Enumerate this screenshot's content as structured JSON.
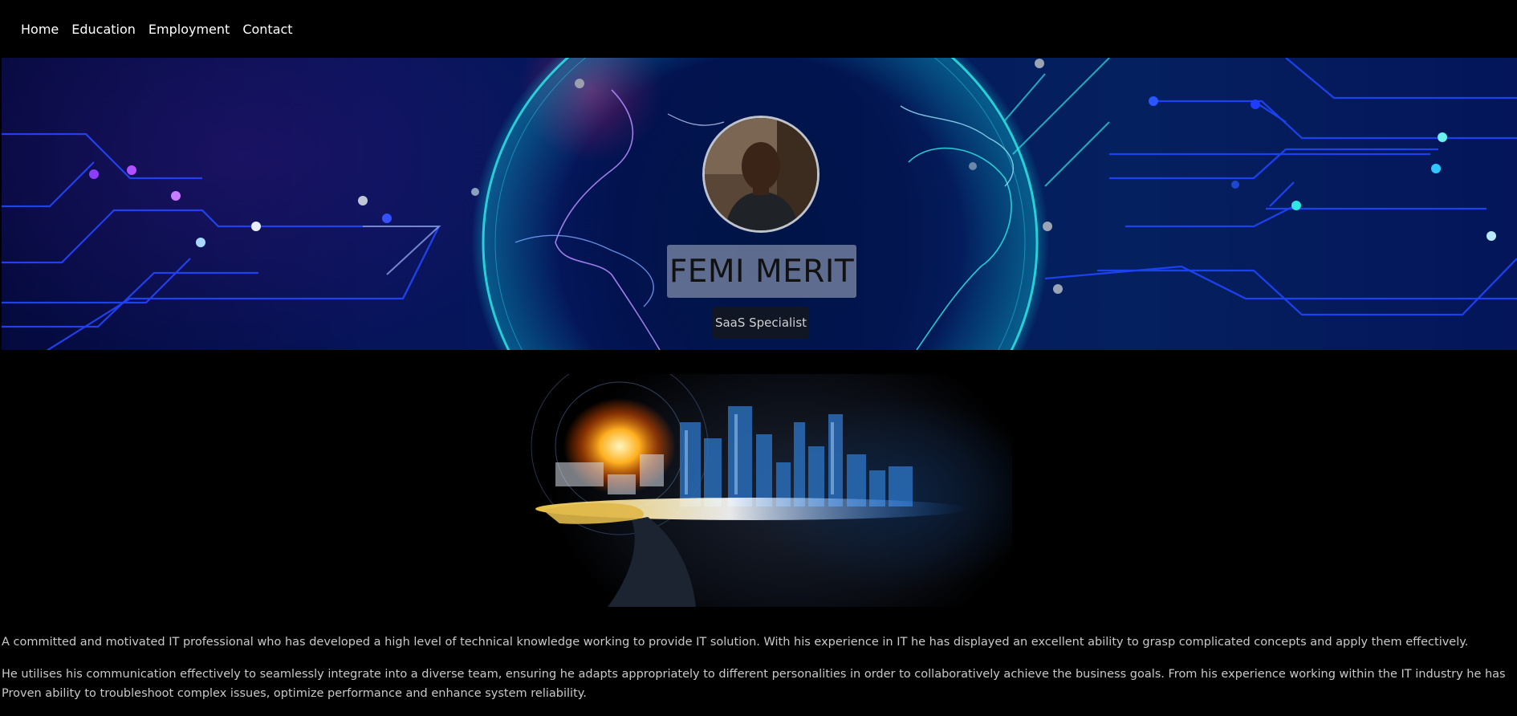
{
  "nav": {
    "items": [
      {
        "label": "Home"
      },
      {
        "label": "Education"
      },
      {
        "label": "Employment"
      },
      {
        "label": "Contact"
      }
    ]
  },
  "hero": {
    "name": "FEMI MERIT",
    "role": "SaaS Specialist"
  },
  "about": {
    "paragraphs": [
      "A committed and motivated IT professional who has developed a high level of technical knowledge working to provide IT solution. With his experience in IT he has displayed an excellent ability to grasp complicated concepts and apply them effectively.",
      "He utilises his communication effectively to seamlessly integrate into a diverse team, ensuring he adapts appropriately to different personalities in order to collaboratively achieve the business goals. From his experience working within the IT industry he has Proven ability to troubleshoot complex issues, optimize performance and enhance system reliability."
    ]
  },
  "colors": {
    "background": "#000000",
    "nav_text": "#ffffff",
    "body_text": "#c9c9c9",
    "globe_cyan": "#2ee6e6",
    "circuit_blue": "#2446ff"
  }
}
